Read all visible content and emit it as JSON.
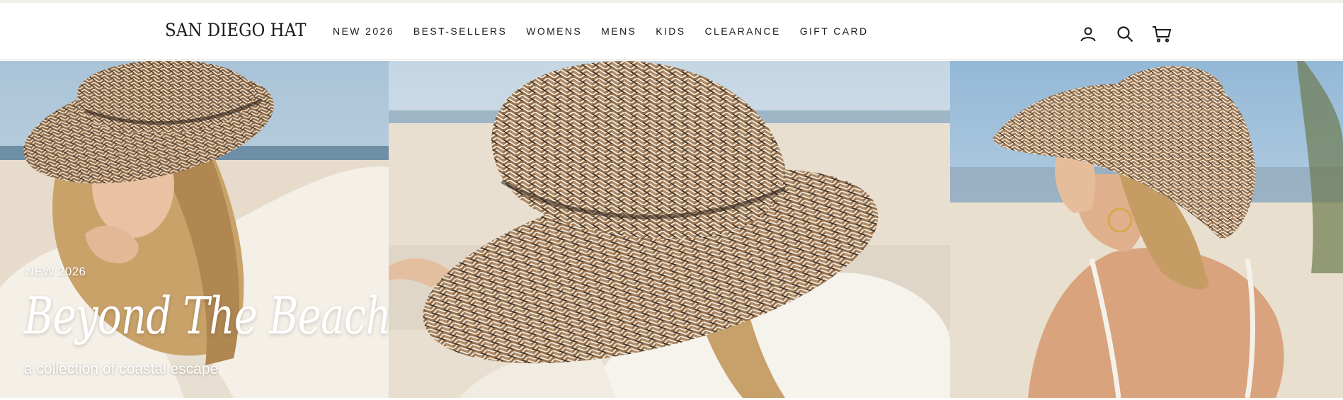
{
  "header": {
    "logo": "SAN DIEGO HAT",
    "nav": [
      {
        "label": "NEW 2026"
      },
      {
        "label": "BEST-SELLERS"
      },
      {
        "label": "WOMENS"
      },
      {
        "label": "MENS"
      },
      {
        "label": "KIDS"
      },
      {
        "label": "CLEARANCE"
      },
      {
        "label": "GIFT CARD"
      }
    ],
    "icons": [
      "account-icon",
      "search-icon",
      "cart-icon"
    ]
  },
  "hero": {
    "eyebrow": "NEW 2026",
    "headline": "Beyond The Beach",
    "subline": "a collection of coastal escape"
  },
  "colors": {
    "text_dark": "#1a1a1a",
    "sky": "#b7cde0",
    "sand": "#e9ddc9",
    "straw": "#9a7350",
    "linen": "#f3efe6"
  }
}
